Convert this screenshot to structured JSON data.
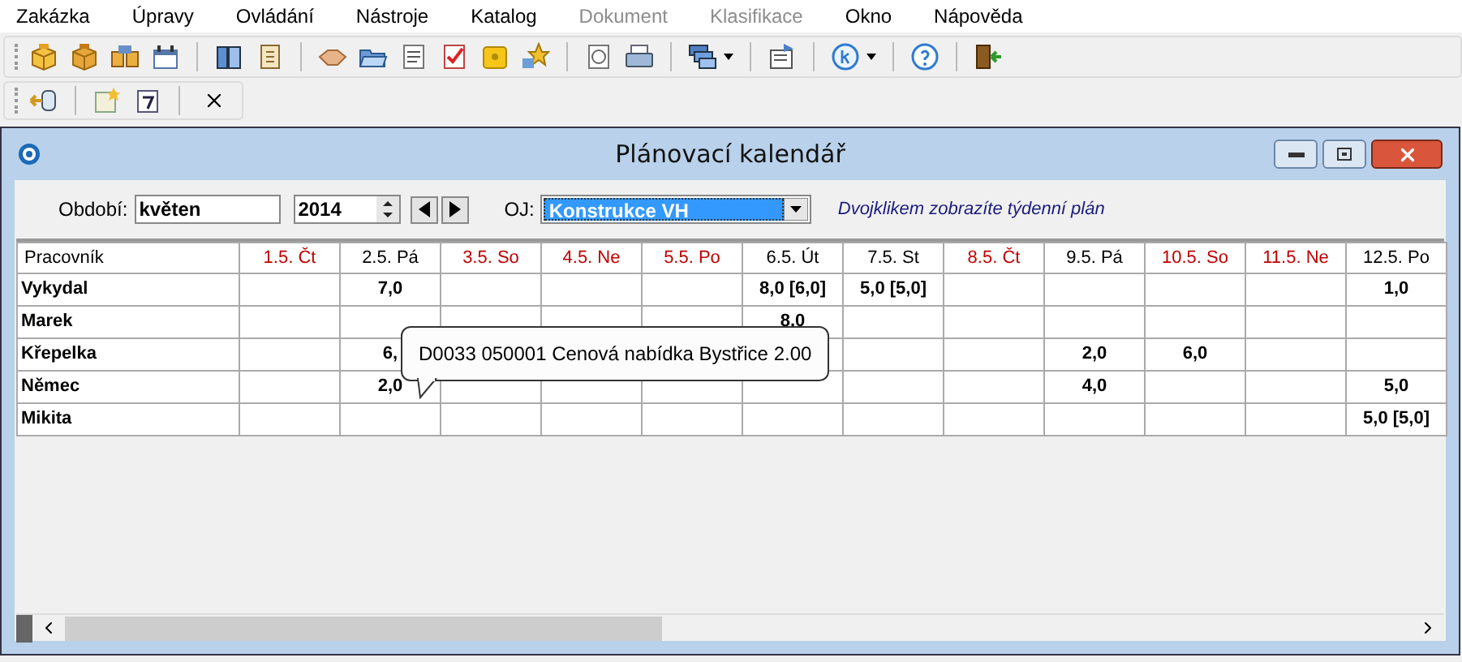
{
  "menu": [
    {
      "label": "Zakázka",
      "disabled": false
    },
    {
      "label": "Úpravy",
      "disabled": false
    },
    {
      "label": "Ovládání",
      "disabled": false
    },
    {
      "label": "Nástroje",
      "disabled": false
    },
    {
      "label": "Katalog",
      "disabled": false
    },
    {
      "label": "Dokument",
      "disabled": true
    },
    {
      "label": "Klasifikace",
      "disabled": true
    },
    {
      "label": "Okno",
      "disabled": false
    },
    {
      "label": "Nápověda",
      "disabled": false
    }
  ],
  "window": {
    "title": "Plánovací kalendář"
  },
  "filter": {
    "period_label": "Období:",
    "period": "květen",
    "year": "2014",
    "unit_label": "OJ:",
    "unit": "Konstrukce VH",
    "hint": "Dvojklikem zobrazíte týdenní plán"
  },
  "table": {
    "name_column": "Pracovník",
    "days": [
      {
        "label": "1.5. Čt",
        "holiday": true
      },
      {
        "label": "2.5. Pá",
        "holiday": false
      },
      {
        "label": "3.5. So",
        "holiday": true
      },
      {
        "label": "4.5. Ne",
        "holiday": true
      },
      {
        "label": "5.5. Po",
        "holiday": true
      },
      {
        "label": "6.5. Út",
        "holiday": false
      },
      {
        "label": "7.5. St",
        "holiday": false
      },
      {
        "label": "8.5. Čt",
        "holiday": true
      },
      {
        "label": "9.5. Pá",
        "holiday": false
      },
      {
        "label": "10.5. So",
        "holiday": true
      },
      {
        "label": "11.5. Ne",
        "holiday": true
      },
      {
        "label": "12.5. Po",
        "holiday": false
      }
    ],
    "rows": [
      {
        "name": "Vykydal",
        "cells": [
          null,
          "7,0",
          null,
          null,
          null,
          "8,0 [6,0]",
          "5,0 [5,0]",
          null,
          null,
          null,
          null,
          "1,0"
        ]
      },
      {
        "name": "Marek",
        "cells": [
          null,
          null,
          null,
          null,
          null,
          "8,0",
          null,
          null,
          null,
          null,
          null,
          null
        ]
      },
      {
        "name": "Křepelka",
        "cells": [
          null,
          "6,",
          null,
          null,
          null,
          null,
          null,
          null,
          "2,0",
          "6,0",
          null,
          null
        ]
      },
      {
        "name": "Němec",
        "cells": [
          null,
          "2,0",
          null,
          null,
          null,
          null,
          null,
          null,
          "4,0",
          null,
          null,
          "5,0"
        ]
      },
      {
        "name": "Mikita",
        "cells": [
          null,
          null,
          null,
          null,
          null,
          null,
          null,
          null,
          null,
          null,
          null,
          "5,0 [5,0]"
        ]
      }
    ]
  },
  "tooltip": {
    "text": "D0033 050001 Cenová nabídka Bystřice 2.00"
  }
}
